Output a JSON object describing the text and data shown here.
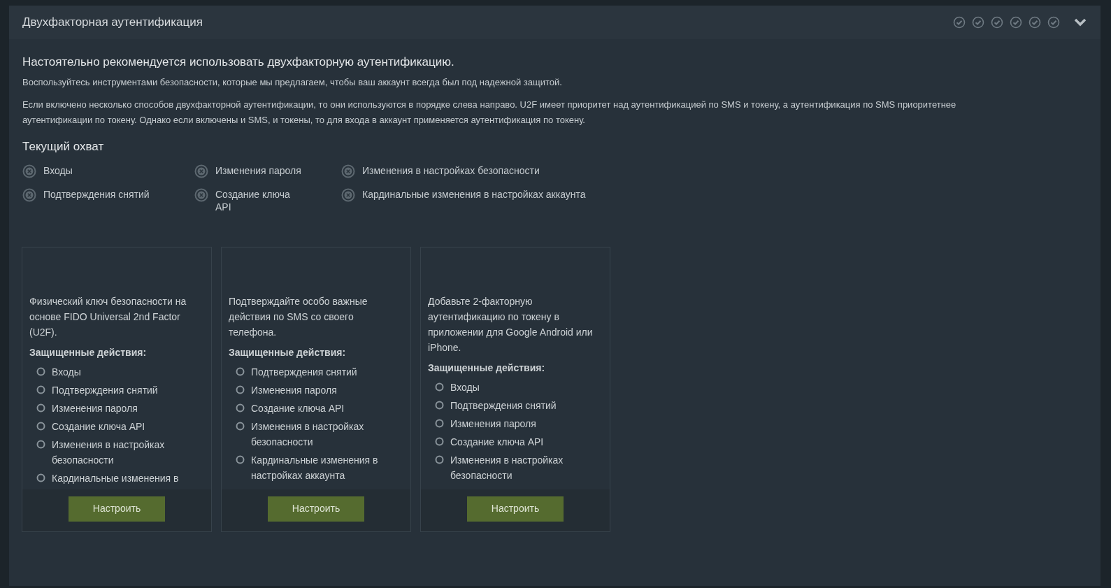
{
  "panel": {
    "title": "Двухфакторная аутентификация",
    "expanded": true
  },
  "intro": {
    "headline": "Настоятельно рекомендуется использовать двухфакторную аутентификацию.",
    "lead": "Воспользуйтесь инструментами безопасности, которые мы предлагаем, чтобы ваш аккаунт всегда был под надежной защитой.",
    "note": "Если включено несколько способов двухфакторной аутентификации, то они используются в порядке слева направо. U2F имеет приоритет над аутентификацией по SMS и токену, а аутентификация по SMS приоритетнее аутентификации по токену. Однако если включены и SMS, и токены, то для входа в аккаунт применяется аутентификация по токену."
  },
  "coverage": {
    "title": "Текущий охват",
    "columns": [
      [
        "Входы",
        "Подтверждения снятий"
      ],
      [
        "Изменения пароля",
        "Создание ключа API"
      ],
      [
        "Изменения в настройках безопасности",
        "Кардинальные изменения в настройках аккаунта"
      ]
    ]
  },
  "methods": [
    {
      "description": "Физический ключ безопасности на основе FIDO Universal 2nd Factor (U2F).",
      "actions_label": "Защищенные действия:",
      "actions": [
        "Входы",
        "Подтверждения снятий",
        "Изменения пароля",
        "Создание ключа API",
        "Изменения в настройках безопасности",
        "Кардинальные изменения в"
      ],
      "button": "Настроить"
    },
    {
      "description": "Подтверждайте особо важные действия по SMS со своего телефона.",
      "actions_label": "Защищенные действия:",
      "actions": [
        "Подтверждения снятий",
        "Изменения пароля",
        "Создание ключа API",
        "Изменения в настройках безопасности",
        "Кардинальные изменения в настройках аккаунта"
      ],
      "button": "Настроить"
    },
    {
      "description": "Добавьте 2-факторную аутентификацию по токену в приложении для Google Android или iPhone.",
      "actions_label": "Защищенные действия:",
      "actions": [
        "Входы",
        "Подтверждения снятий",
        "Изменения пароля",
        "Создание ключа API",
        "Изменения в настройках безопасности"
      ],
      "button": "Настроить"
    }
  ]
}
